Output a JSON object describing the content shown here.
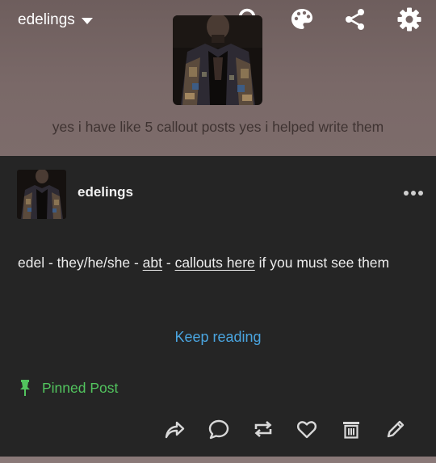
{
  "header": {
    "blog_name": "edelings",
    "description": "yes i have like 5 callout posts yes i helped write them",
    "icons": [
      "search-icon",
      "palette-icon",
      "share-icon",
      "gear-icon",
      "chevron-down-icon"
    ]
  },
  "post": {
    "author": "edelings",
    "body_prefix": "edel - they/he/she - ",
    "link_abt": "abt",
    "separator": " - ",
    "link_callouts": "callouts here",
    "body_suffix": " if you must see them",
    "keep_reading": "Keep reading",
    "pinned_label": "Pinned Post",
    "actions": [
      "share-icon",
      "reply-icon",
      "reblog-icon",
      "like-icon",
      "delete-icon",
      "edit-icon"
    ]
  },
  "colors": {
    "header_bg": "#7a6968",
    "post_bg": "#252525",
    "link_blue": "#4aa5e0",
    "pinned_green": "#52c45e"
  }
}
